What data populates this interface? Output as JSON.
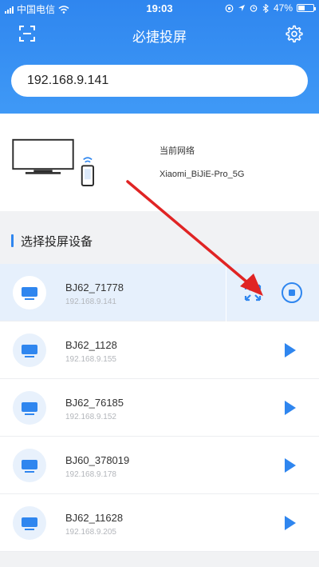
{
  "status_bar": {
    "carrier": "中国电信",
    "time": "19:03",
    "battery": "47%",
    "battery_level": 0.47
  },
  "header": {
    "title": "必捷投屏",
    "ip_value": "192.168.9.141",
    "scan_icon": "scan-icon",
    "settings_icon": "gear-icon"
  },
  "network": {
    "label": "当前网络",
    "ssid": "Xiaomi_BiJiE-Pro_5G"
  },
  "section": {
    "title": "选择投屏设备"
  },
  "devices": [
    {
      "name": "BJ62_71778",
      "ip": "192.168.9.141",
      "active": true
    },
    {
      "name": "BJ62_1128",
      "ip": "192.168.9.155",
      "active": false
    },
    {
      "name": "BJ62_76185",
      "ip": "192.168.9.152",
      "active": false
    },
    {
      "name": "BJ60_378019",
      "ip": "192.168.9.178",
      "active": false
    },
    {
      "name": "BJ62_11628",
      "ip": "192.168.9.205",
      "active": false
    }
  ],
  "colors": {
    "accent": "#2f86ef",
    "annotation_arrow": "#e02424"
  }
}
